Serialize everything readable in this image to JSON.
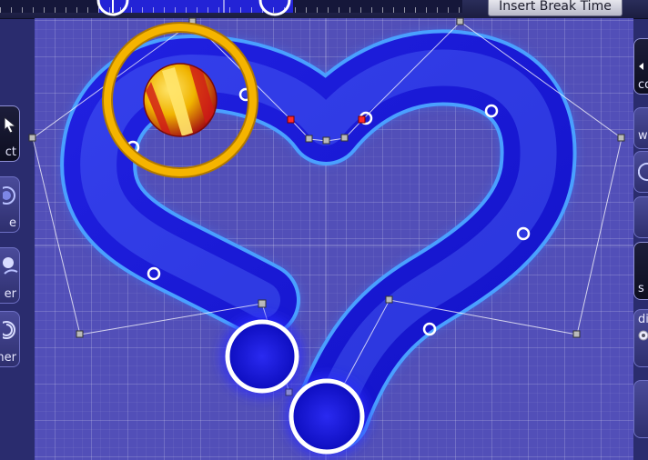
{
  "timeline": {
    "insert_break_label": "Insert Break Time"
  },
  "left_toolbar": {
    "tools": [
      {
        "label": "ct",
        "icon": "select-cursor-icon",
        "active": true
      },
      {
        "label": "e",
        "icon": "circle-target-icon",
        "active": false
      },
      {
        "label": "er",
        "icon": "slider-ball-icon",
        "active": false
      },
      {
        "label": "ner",
        "icon": "spinner-icon",
        "active": false
      }
    ]
  },
  "right_toolbar": {
    "items": [
      {
        "label": "co",
        "icon": "arrow-left-icon"
      },
      {
        "label": "w",
        "icon": ""
      },
      {
        "label": "",
        "icon": "refresh-icon"
      },
      {
        "label": "",
        "icon": ""
      },
      {
        "label": "s",
        "icon": ""
      },
      {
        "label": "di",
        "icon": "radio-icon"
      },
      {
        "label": "",
        "icon": ""
      }
    ]
  },
  "colors": {
    "grid_background": "#524fb8",
    "slider_body": "#1a1ad6",
    "slider_border": "#4aa0ff",
    "approach_ring": "#f5b400",
    "timeline_accent": "#2323d6"
  }
}
